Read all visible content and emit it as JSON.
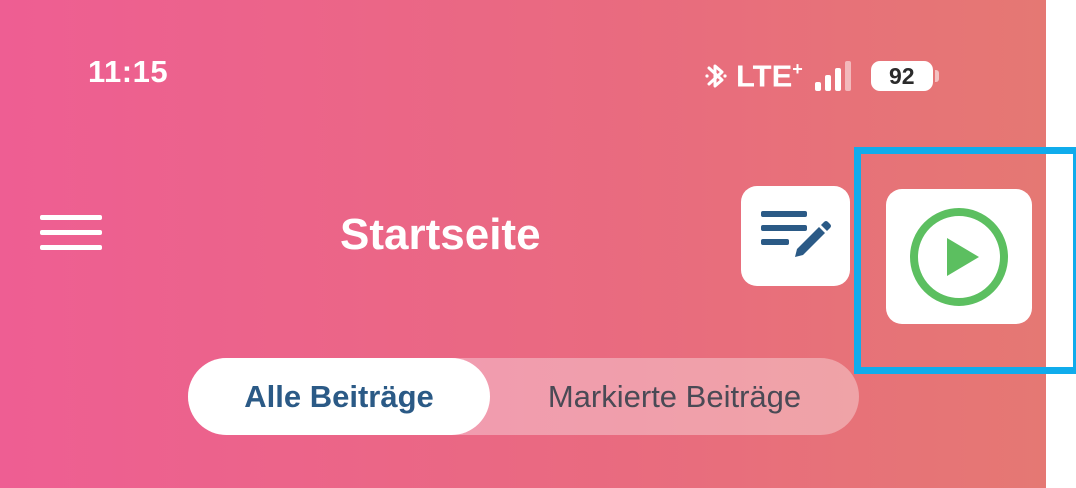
{
  "status_bar": {
    "time": "11:15",
    "network": "LTE",
    "network_suffix": "+",
    "battery": "92"
  },
  "header": {
    "title": "Startseite",
    "menu_icon": "hamburger-menu-icon",
    "edit_icon": "list-edit-icon",
    "play_icon": "play-circle-icon"
  },
  "tabs": [
    {
      "label": "Alle Beiträge",
      "active": true
    },
    {
      "label": "Markierte Beiträge",
      "active": false
    }
  ],
  "colors": {
    "gradient_start": "#ee5e93",
    "gradient_end": "#e57873",
    "icon_blue": "#2b5a86",
    "play_green": "#5cbf60",
    "highlight": "#10acec"
  }
}
